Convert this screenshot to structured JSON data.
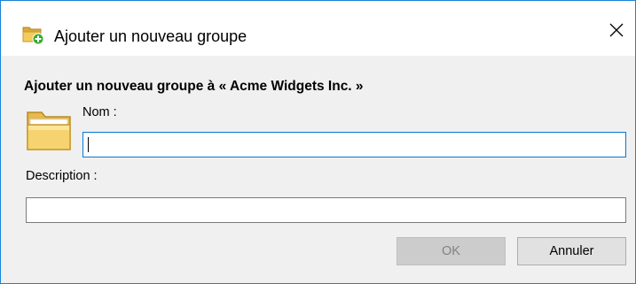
{
  "window": {
    "title": "Ajouter un nouveau groupe",
    "accent_color": "#1883d7",
    "title_icon": "folder-add-icon",
    "close_icon": "close-icon"
  },
  "form": {
    "heading": "Ajouter un nouveau groupe à « Acme Widgets Inc. »",
    "folder_icon": "folder-icon",
    "name": {
      "label": "Nom :",
      "value": ""
    },
    "description": {
      "label": "Description :",
      "value": ""
    }
  },
  "buttons": {
    "ok_label": "OK",
    "ok_state": "disabled",
    "cancel_label": "Annuler"
  }
}
